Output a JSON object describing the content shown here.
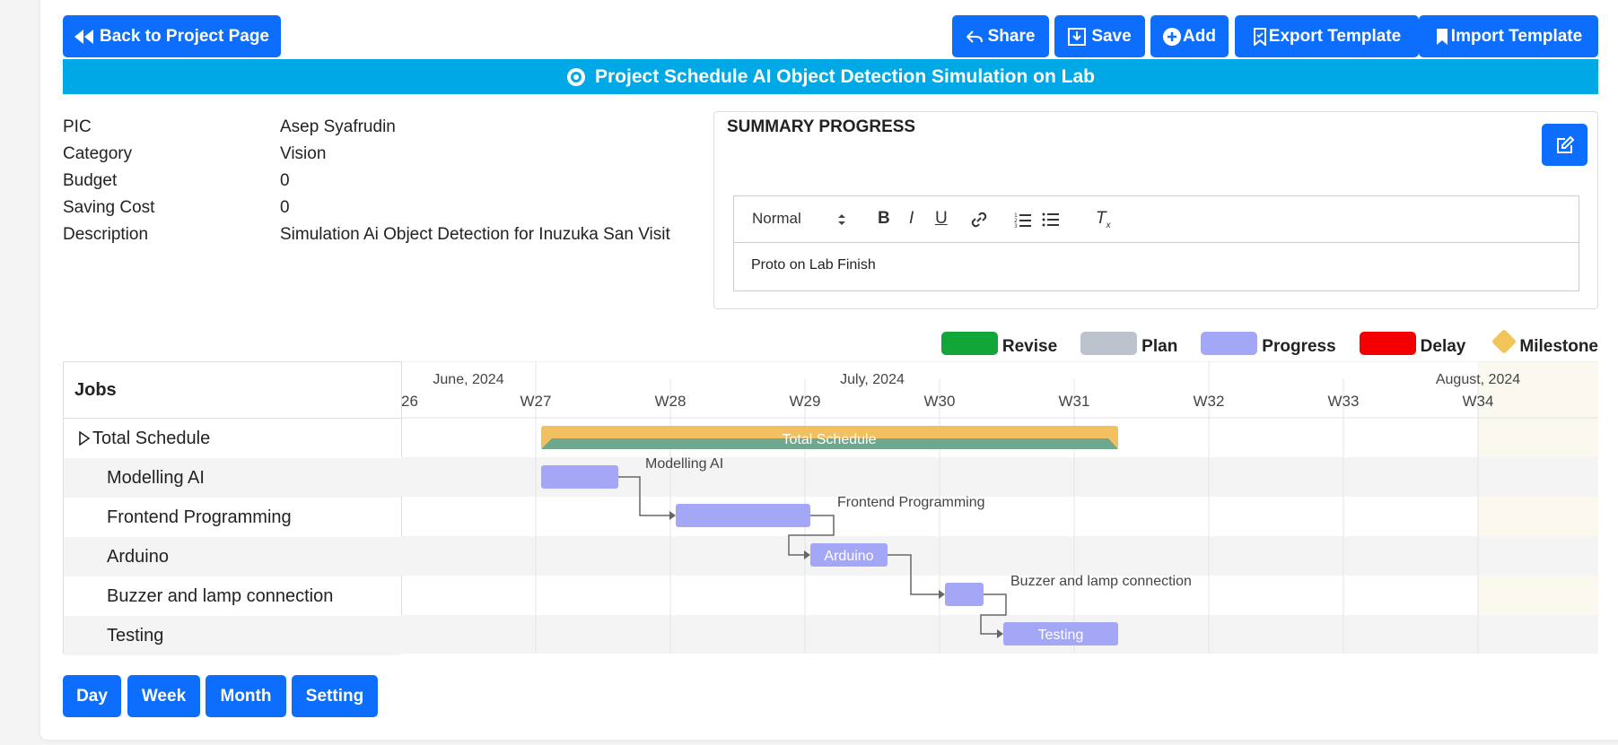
{
  "toolbar": {
    "back_label": "Back to Project Page",
    "share_label": "Share",
    "save_label": "Save",
    "add_label": "Add",
    "export_label": "Export Template",
    "import_label": "Import Template"
  },
  "title": "Project Schedule AI Object Detection Simulation on Lab",
  "info": {
    "rows": [
      {
        "label": "PIC",
        "value": "Asep Syafrudin"
      },
      {
        "label": "Category",
        "value": "Vision"
      },
      {
        "label": "Budget",
        "value": "0"
      },
      {
        "label": "Saving Cost",
        "value": "0"
      },
      {
        "label": "Description",
        "value": "Simulation Ai Object Detection for Inuzuka San Visit"
      }
    ]
  },
  "summary": {
    "heading": "SUMMARY PROGRESS",
    "format_select": "Normal",
    "content": "Proto on Lab Finish"
  },
  "legend": [
    {
      "label": "Revise",
      "color": "#12a537"
    },
    {
      "label": "Plan",
      "color": "#bcc3cc"
    },
    {
      "label": "Progress",
      "color": "#a4a6f6"
    },
    {
      "label": "Delay",
      "color": "#f40000"
    },
    {
      "label": "Milestone",
      "color": "#f2c55a"
    }
  ],
  "gantt": {
    "jobs_header": "Jobs",
    "months": [
      "June, 2024",
      "July, 2024",
      "August, 2024"
    ],
    "weeks": [
      "26",
      "W27",
      "W28",
      "W29",
      "W30",
      "W31",
      "W32",
      "W33",
      "W34"
    ],
    "tasks": [
      {
        "name": "Total Schedule",
        "bar_label": "Total Schedule"
      },
      {
        "name": "Modelling AI",
        "bar_label": "Modelling AI"
      },
      {
        "name": "Frontend Programming",
        "bar_label": "Frontend Programming"
      },
      {
        "name": "Arduino",
        "bar_label": "Arduino"
      },
      {
        "name": "Buzzer and lamp connection",
        "bar_label": "Buzzer and lamp connection"
      },
      {
        "name": "Testing",
        "bar_label": "Testing"
      }
    ],
    "colors": {
      "progress": "#a4a6f6",
      "total_top": "#f2c05e",
      "total_bottom": "#6fa88e",
      "weekend": "#faf8ef"
    }
  },
  "view_buttons": [
    "Day",
    "Week",
    "Month",
    "Setting"
  ]
}
